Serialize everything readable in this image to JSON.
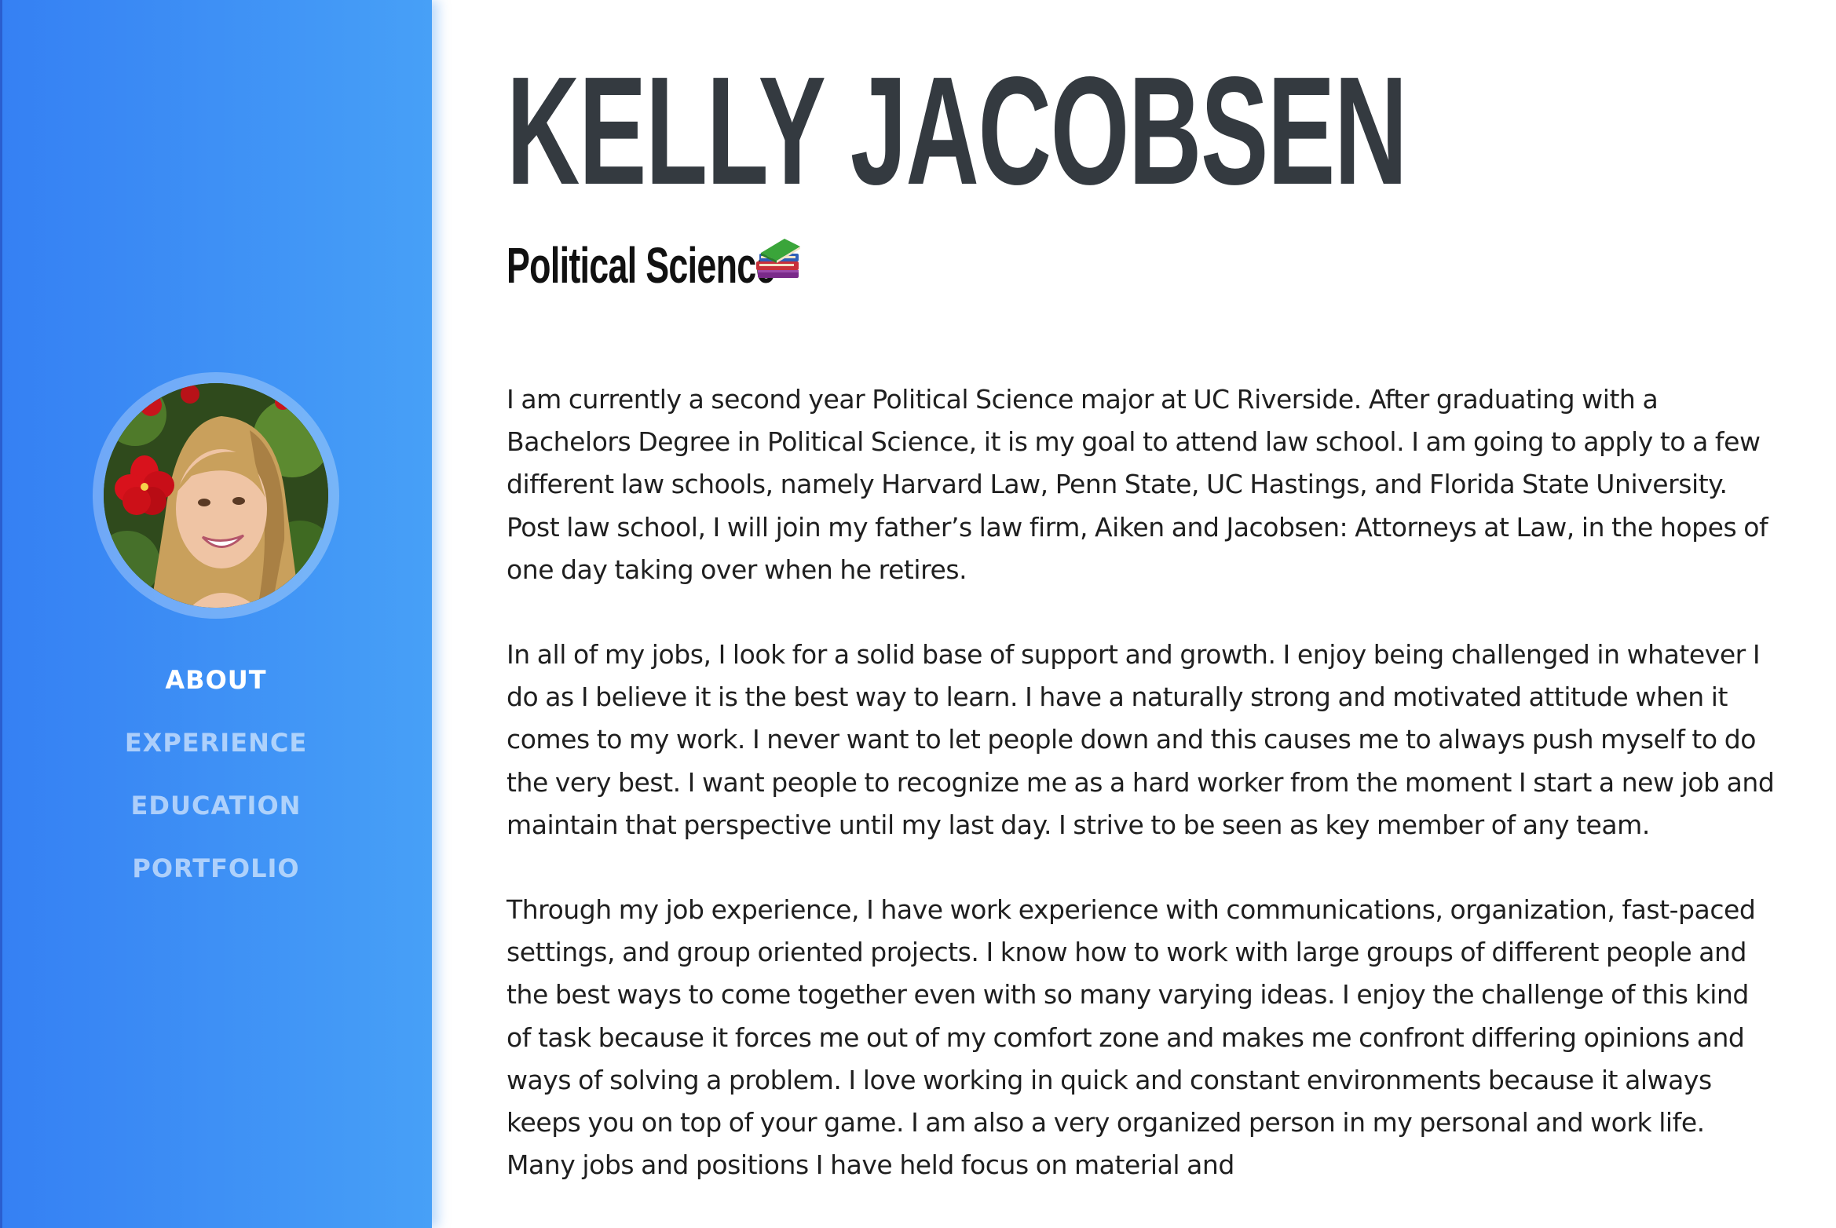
{
  "sidebar": {
    "avatar_alt": "Profile photo",
    "nav": [
      {
        "label": "ABOUT",
        "active": true
      },
      {
        "label": "EXPERIENCE",
        "active": false
      },
      {
        "label": "EDUCATION",
        "active": false
      },
      {
        "label": "PORTFOLIO",
        "active": false
      }
    ]
  },
  "header": {
    "name": "KELLY JACOBSEN",
    "subtitle": "Political Science",
    "subtitle_icon": "books-icon"
  },
  "about": {
    "paragraphs": [
      "I am currently a second year Political Science major at UC Riverside. After graduating with a Bachelors Degree in Political Science, it is my goal to attend law school. I am going to apply to a few different law schools, namely Harvard Law, Penn State, UC Hastings, and Florida State University. Post law school, I will join my father’s law firm, Aiken and Jacobsen: Attorneys at Law, in the hopes of one day taking over when he retires.",
      "In all of my jobs, I look for a solid base of support and growth. I enjoy being challenged in whatever I do as I believe it is the best way to learn. I have a naturally strong and motivated attitude when it comes to my work. I never want to let people down and this causes me to always push myself to do the very best. I want people to recognize me as a hard worker from the moment I start a new job and maintain that perspective until my last day. I strive to be seen as key member of any team.",
      "Through my job experience, I have work experience with communications, organization, fast-paced settings, and group oriented projects. I know how to work with large groups of different people and the best ways to come together even with so many varying ideas. I enjoy the challenge of this kind of task because it forces me out of my comfort zone and makes me confront differing opinions and ways of solving a problem. I love working in quick and constant environments because it always keeps you on top of your game. I am also a very organized person in my personal and work life. Many jobs and positions I have held focus on material and"
    ]
  },
  "colors": {
    "sidebar_start": "#3580f3",
    "sidebar_end": "#47a0f7",
    "heading": "#343a40",
    "body_text": "#1f1f1f"
  }
}
